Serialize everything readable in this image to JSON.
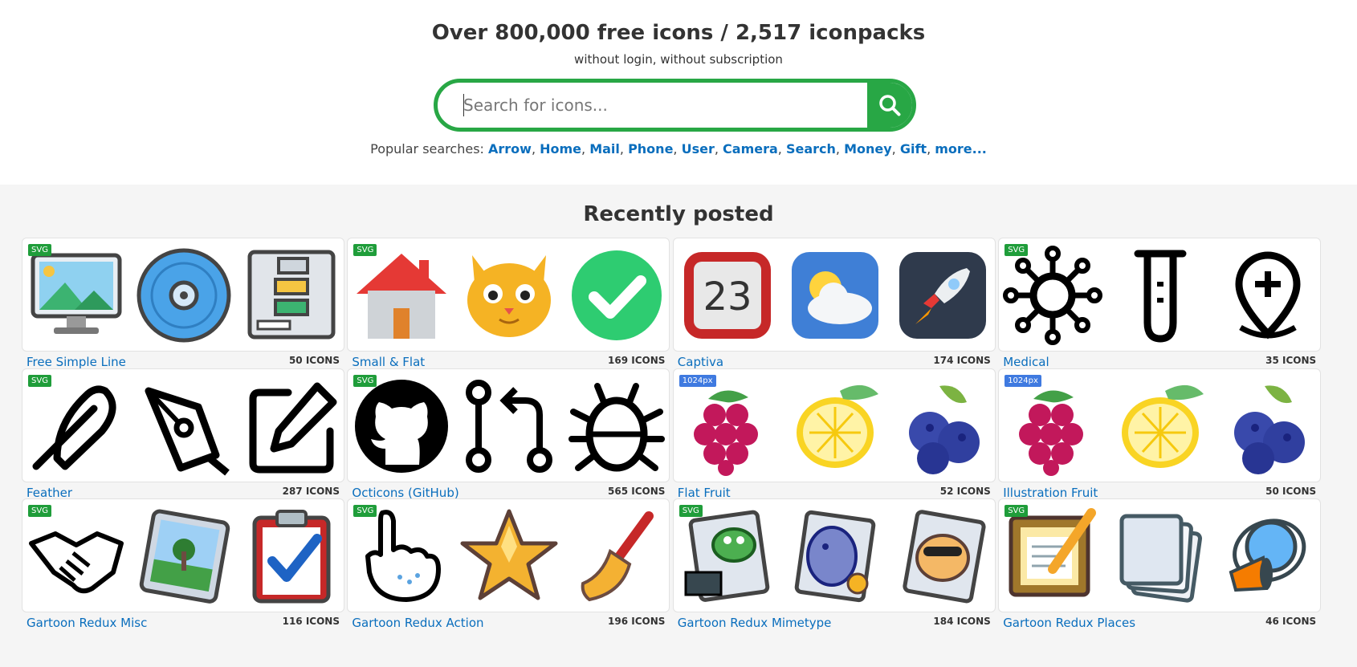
{
  "hero": {
    "title": "Over 800,000 free icons / 2,517 iconpacks",
    "subtitle": "without login, without subscription"
  },
  "search": {
    "placeholder": "Search for icons...",
    "button_icon": "search-icon"
  },
  "popular": {
    "label": "Popular searches:",
    "items": [
      "Arrow",
      "Home",
      "Mail",
      "Phone",
      "User",
      "Camera",
      "Search",
      "Money",
      "Gift",
      "more..."
    ]
  },
  "recent": {
    "heading": "Recently posted",
    "packs": [
      {
        "title": "Free Simple Line",
        "count": "50 ICONS",
        "badge": "SVG",
        "icons": [
          "monitor-image-icon",
          "disc-icon",
          "flowchart-icon"
        ]
      },
      {
        "title": "Small & Flat",
        "count": "169 ICONS",
        "badge": "SVG",
        "icons": [
          "house-icon",
          "cat-icon",
          "check-circle-icon"
        ]
      },
      {
        "title": "Captiva",
        "count": "174 ICONS",
        "badge": "",
        "icons": [
          "calendar-icon",
          "weather-cloud-icon",
          "rocket-icon"
        ]
      },
      {
        "title": "Medical",
        "count": "35 ICONS",
        "badge": "SVG",
        "icons": [
          "virus-icon",
          "test-tube-icon",
          "location-plus-icon"
        ]
      },
      {
        "title": "Feather",
        "count": "287 ICONS",
        "badge": "SVG",
        "icons": [
          "feather-icon",
          "pen-tool-icon",
          "edit-icon"
        ]
      },
      {
        "title": "Octicons (GitHub)",
        "count": "565 ICONS",
        "badge": "SVG",
        "icons": [
          "github-icon",
          "pull-request-icon",
          "bug-icon"
        ]
      },
      {
        "title": "Flat Fruit",
        "count": "52 ICONS",
        "badge": "1024px",
        "icons": [
          "raspberry-icon",
          "lemon-icon",
          "blueberry-icon"
        ]
      },
      {
        "title": "Illustration Fruit",
        "count": "50 ICONS",
        "badge": "1024px",
        "icons": [
          "raspberry-icon",
          "lemon-icon",
          "blueberry-icon"
        ]
      },
      {
        "title": "Gartoon Redux Misc",
        "count": "116 ICONS",
        "badge": "SVG",
        "icons": [
          "handshake-icon",
          "picture-icon",
          "clipboard-check-icon"
        ]
      },
      {
        "title": "Gartoon Redux Action",
        "count": "196 ICONS",
        "badge": "SVG",
        "icons": [
          "pointing-hand-icon",
          "star-icon",
          "broom-icon"
        ]
      },
      {
        "title": "Gartoon Redux Mimetype",
        "count": "184 ICONS",
        "badge": "SVG",
        "icons": [
          "python-file-icon",
          "php-file-icon",
          "perl-file-icon"
        ]
      },
      {
        "title": "Gartoon Redux Places",
        "count": "46 ICONS",
        "badge": "SVG",
        "icons": [
          "notepad-pencil-icon",
          "documents-icon",
          "megaphone-icon"
        ]
      }
    ]
  },
  "colors": {
    "accent": "#28a745",
    "link": "#0a6ebd",
    "badge_svg": "#1f9d3a",
    "badge_px": "#3f7ae0",
    "section_bg": "#f5f5f5"
  }
}
